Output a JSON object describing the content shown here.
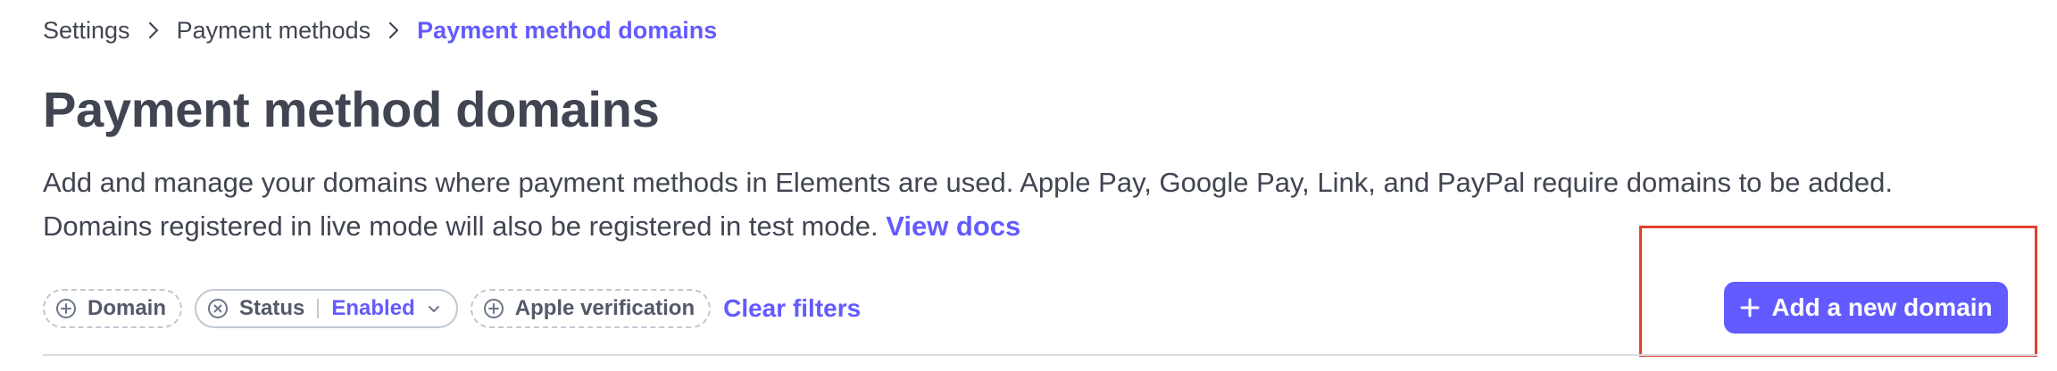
{
  "breadcrumb": {
    "items": [
      "Settings",
      "Payment methods",
      "Payment method domains"
    ]
  },
  "header": {
    "title": "Payment method domains"
  },
  "description": {
    "text": "Add and manage your domains where payment methods in Elements are used. Apple Pay, Google Pay, Link, and PayPal require domains to be added. Domains registered in live mode will also be registered in test mode.",
    "link_label": "View docs"
  },
  "filters": {
    "domain_label": "Domain",
    "status_label": "Status",
    "status_value": "Enabled",
    "apple_label": "Apple verification",
    "clear_label": "Clear filters"
  },
  "actions": {
    "add_label": "Add a new domain"
  },
  "colors": {
    "accent": "#635bff",
    "text": "#414552",
    "highlight": "#e2402f"
  }
}
